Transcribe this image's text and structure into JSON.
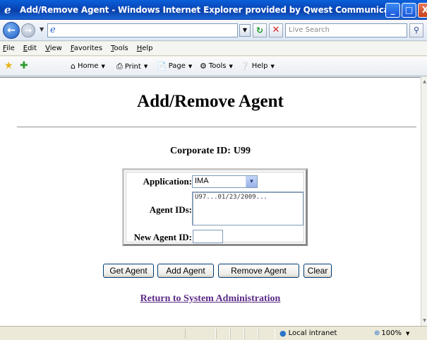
{
  "window": {
    "title": "Add/Remove Agent - Windows Internet Explorer provided by Qwest Communications",
    "min": "_",
    "max": "□",
    "close": "X"
  },
  "addressbar": {
    "url": "",
    "search_placeholder": "Live Search"
  },
  "menu": [
    "File",
    "Edit",
    "View",
    "Favorites",
    "Tools",
    "Help"
  ],
  "commandbar": {
    "home": "Home",
    "print": "Print",
    "page": "Page",
    "tools": "Tools",
    "help": "Help"
  },
  "page": {
    "title": "Add/Remove Agent",
    "corporate_label": "Corporate ID:",
    "corporate_value": "U99",
    "application_label": "Application:",
    "application_value": "IMA",
    "agent_ids_label": "Agent IDs:",
    "agent_ids_value": "U97...01/23/2009...",
    "new_agent_label": "New Agent ID:",
    "new_agent_value": "",
    "buttons": {
      "get": "Get Agent",
      "add": "Add Agent",
      "remove": "Remove Agent",
      "clear": "Clear"
    },
    "return_link": "Return to System Administration"
  },
  "statusbar": {
    "zone": "Local intranet",
    "zoom": "100%"
  },
  "colors": {
    "titlebar": "#0a5fd8",
    "link_visited": "#5b2a86"
  }
}
